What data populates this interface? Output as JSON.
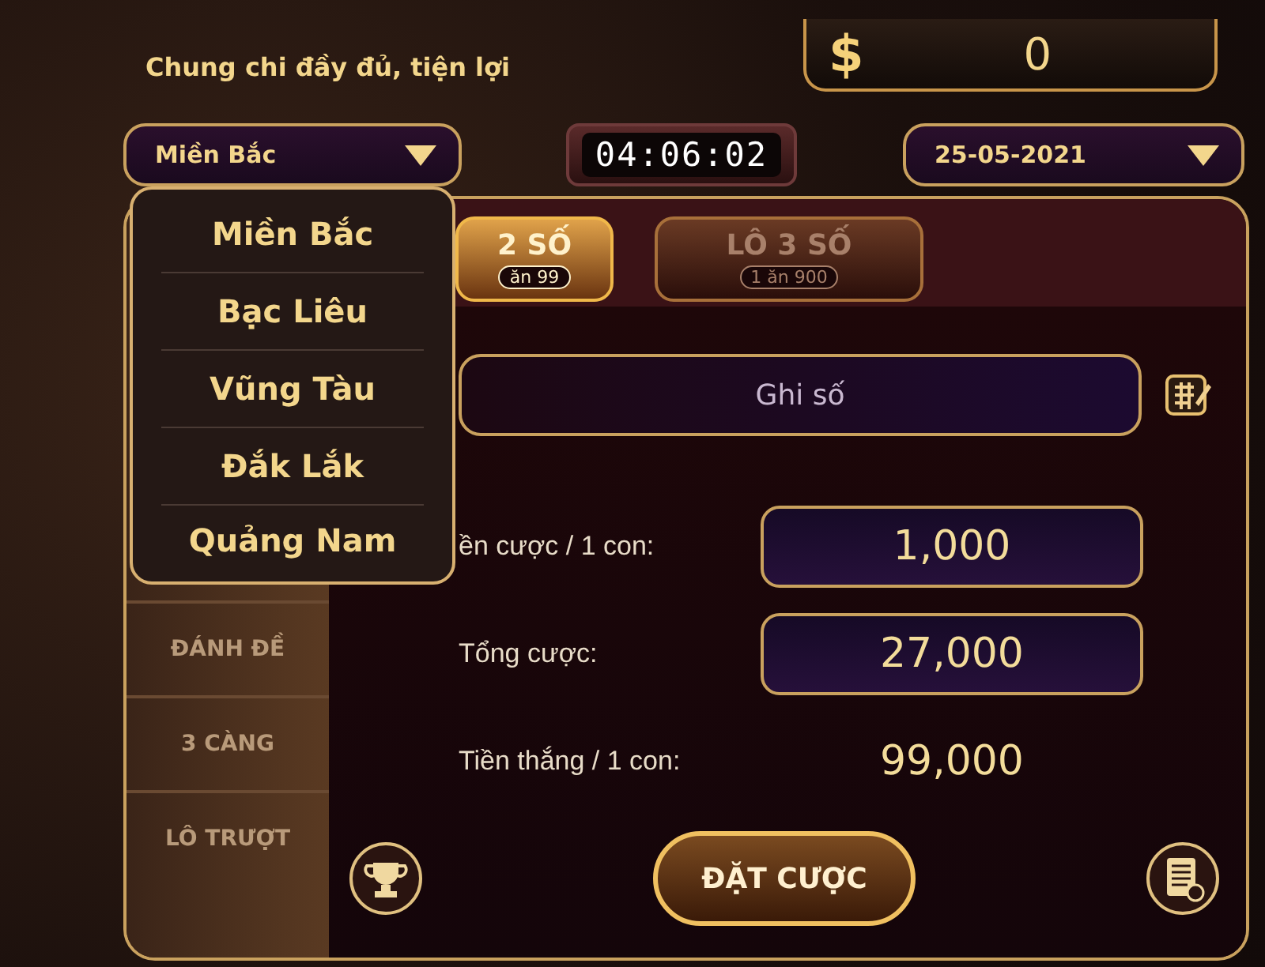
{
  "header": {
    "slogan": "Chung chi đầy đủ, tiện lợi",
    "currency": "$",
    "balance": "0"
  },
  "region_select": {
    "value": "Miền Bắc",
    "expanded": true
  },
  "timer": "04:06:02",
  "date_select": {
    "value": "25-05-2021"
  },
  "region_menu": [
    "Miền Bắc",
    "Bạc Liêu",
    "Vũng Tàu",
    "Đắk Lắk",
    "Quảng Nam"
  ],
  "sidebar": {
    "items": [
      "ĐÁNH ĐỀ",
      "3 CÀNG",
      "LÔ TRƯỢT"
    ]
  },
  "tabs": [
    {
      "label": "2 SỐ",
      "sub": "ăn 99",
      "selected": true
    },
    {
      "label": "LÔ 3 SỐ",
      "sub": "1 ăn 900",
      "selected": false
    }
  ],
  "number_field": {
    "placeholder": "Ghi số"
  },
  "rows": [
    {
      "kind": "field",
      "label": "ền cược / 1 con:",
      "value": "1,000"
    },
    {
      "kind": "field",
      "label": "Tổng cược:",
      "value": "27,000"
    },
    {
      "kind": "text",
      "label": "Tiền thắng / 1 con:",
      "value": "99,000"
    }
  ],
  "bet_button": "ĐẶT CƯỢC"
}
